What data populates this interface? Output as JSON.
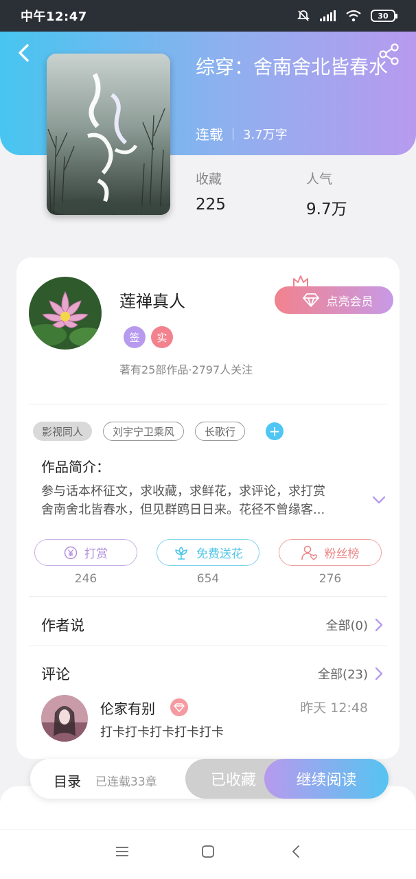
{
  "status_bar": {
    "time": "中午12:47",
    "battery": "30"
  },
  "book": {
    "title": "综穿：舍南舍北皆春水",
    "status": "连载",
    "words": "3.7万字",
    "stats": [
      {
        "label": "收藏",
        "value": "225"
      },
      {
        "label": "人气",
        "value": "9.7万"
      }
    ]
  },
  "author": {
    "name": "莲禅真人",
    "badges": [
      "签",
      "实"
    ],
    "stats": "著有25部作品·2797人关注",
    "vip_button": "点亮会员"
  },
  "tags": [
    "影视同人",
    "刘宇宁卫乘风",
    "长歌行"
  ],
  "intro": {
    "title": "作品简介：",
    "lines": [
      "参与话本杯征文，求收藏，求鲜花，求评论，求打赏",
      "舍南舍北皆春水，但见群鸥日日来。花径不曾缘客..."
    ]
  },
  "actions": [
    {
      "label": "打赏",
      "count": "246",
      "color": "#b28fdc"
    },
    {
      "label": "免费送花",
      "count": "654",
      "color": "#4fc6e6"
    },
    {
      "label": "粉丝榜",
      "count": "276",
      "color": "#ec8686"
    }
  ],
  "author_says": {
    "title": "作者说",
    "more": "全部(0)"
  },
  "comments": {
    "title": "评论",
    "more": "全部(23)",
    "items": [
      {
        "user": "伦家有别",
        "time": "昨天 12:48",
        "text": "打卡打卡打卡打卡打卡"
      }
    ]
  },
  "bottom_bar": {
    "toc": "目录",
    "toc_count": "已连载33章",
    "collected": "已收藏",
    "read": "继续阅读"
  },
  "colors": {
    "accent_blue": "#47c5f0",
    "accent_purple": "#b79aee",
    "badge_pink": "#f2828d"
  }
}
